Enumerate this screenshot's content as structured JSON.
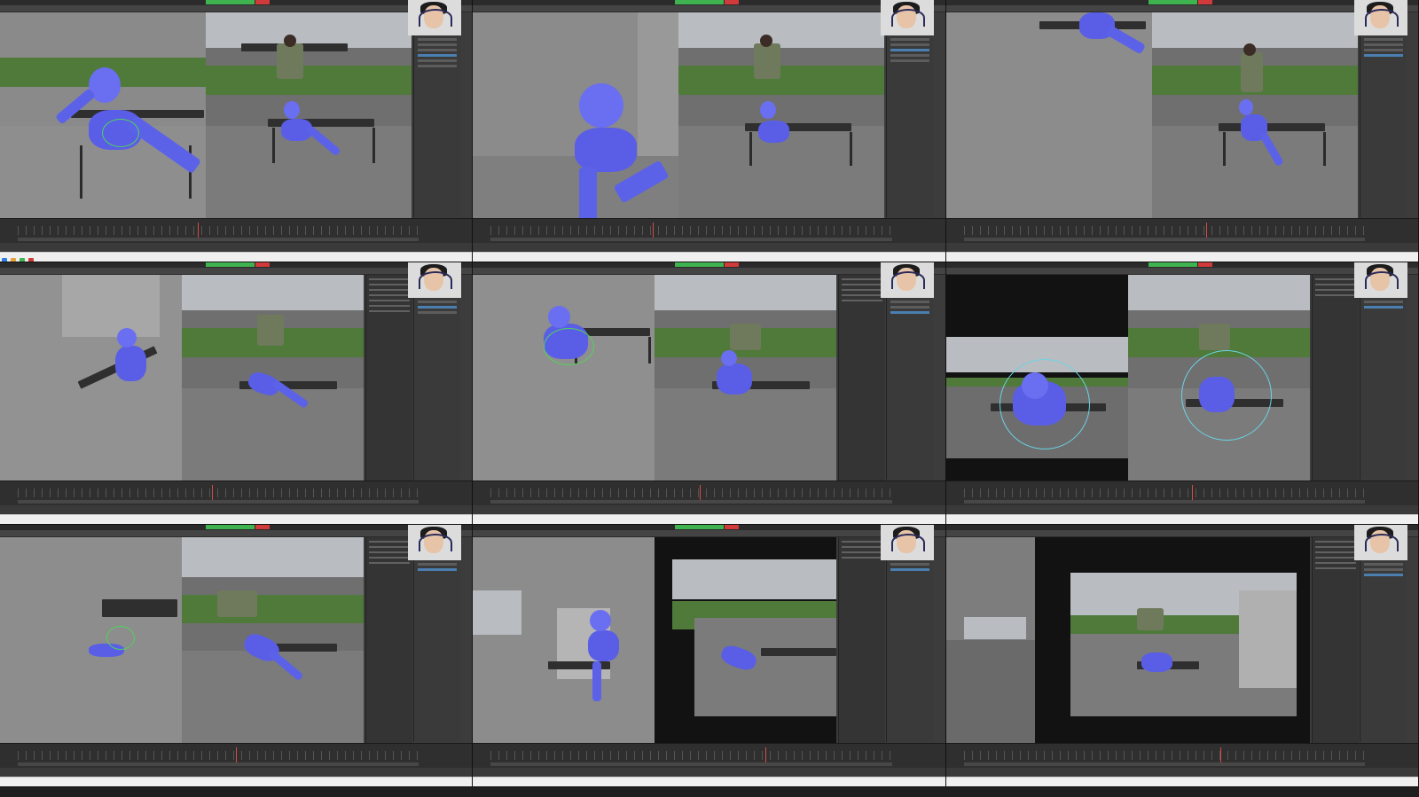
{
  "screen": {
    "description_tiles": 9,
    "accent_record": "#3fb34f",
    "accent_stop": "#d13a3a",
    "robot_color": "#5a5ee6"
  },
  "tiles": [
    {
      "id": "tile-1",
      "webcam_label": "",
      "playhead": 0.42
    },
    {
      "id": "tile-2",
      "webcam_label": "",
      "playhead": 0.38
    },
    {
      "id": "tile-3",
      "webcam_label": "",
      "playhead": 0.55
    },
    {
      "id": "tile-4",
      "webcam_label": "",
      "playhead": 0.45
    },
    {
      "id": "tile-5",
      "webcam_label": "",
      "playhead": 0.48
    },
    {
      "id": "tile-6",
      "webcam_label": "",
      "playhead": 0.52
    },
    {
      "id": "tile-7",
      "webcam_label": "",
      "playhead": 0.5
    },
    {
      "id": "tile-8",
      "webcam_label": "",
      "playhead": 0.62
    },
    {
      "id": "tile-9",
      "webcam_label": "",
      "playhead": 0.58
    }
  ]
}
